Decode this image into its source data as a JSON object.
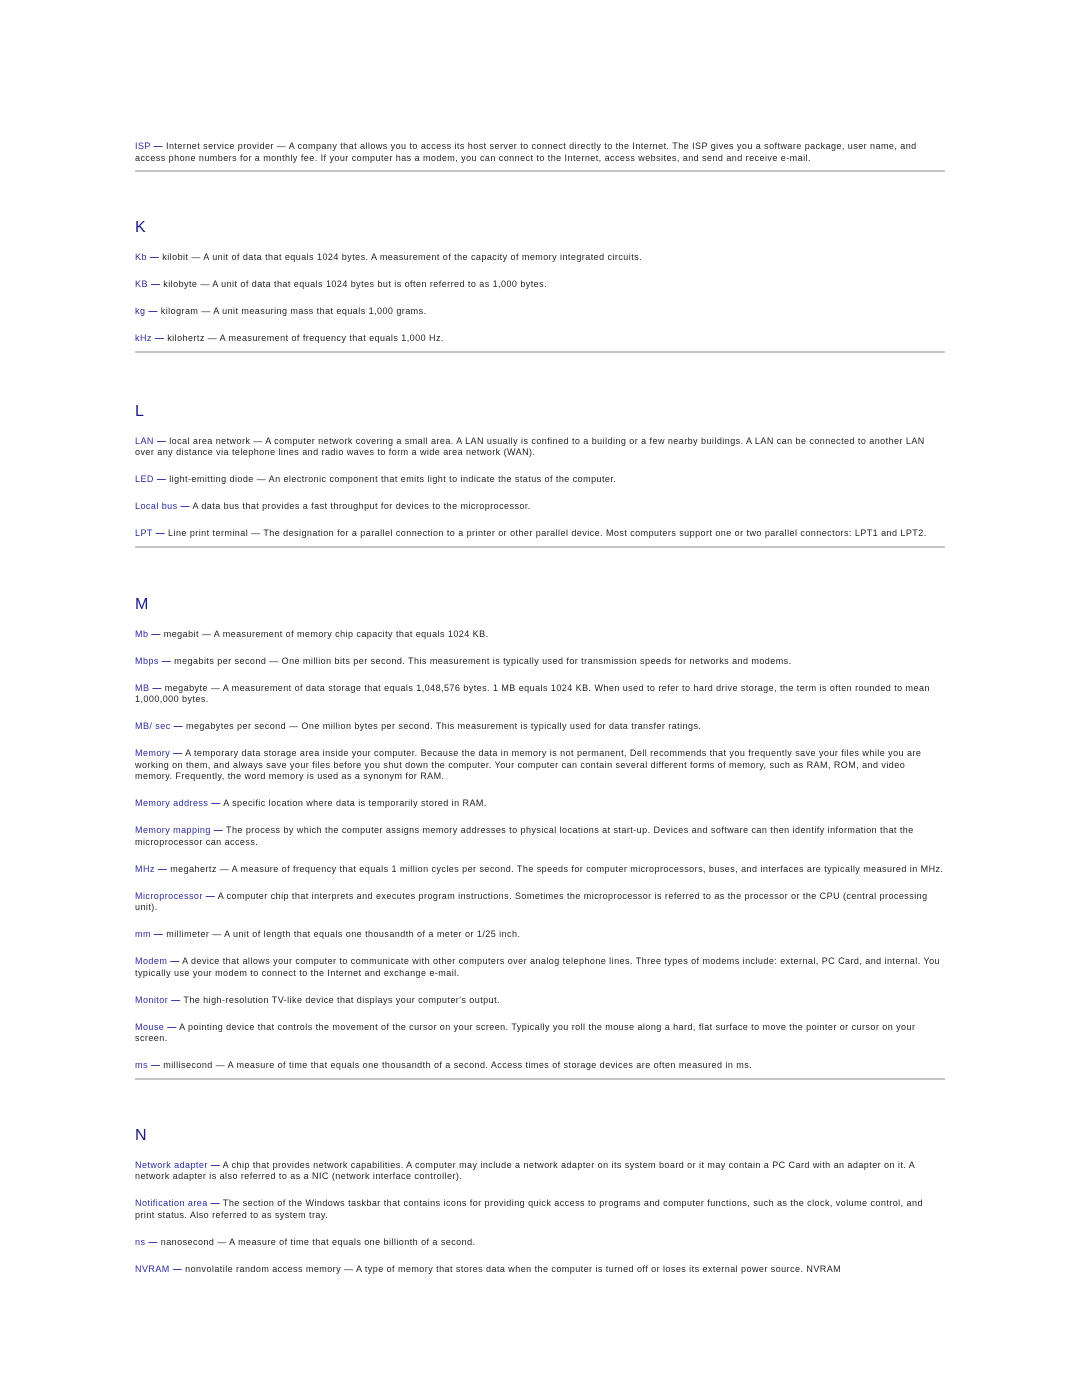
{
  "intro": {
    "term": "ISP",
    "dash": "—",
    "definition": " Internet service provider — A company that allows you to access its host server to connect directly to the Internet. The ISP gives you a software package, user name, and access phone numbers for a monthly fee. If your computer has a modem, you can connect to the Internet, access websites, and send and receive e-mail."
  },
  "sections": [
    {
      "letter": "K",
      "entries": [
        {
          "term": "Kb",
          "definition": " kilobit — A unit of data that equals 1024 bytes. A measurement of the capacity of memory integrated circuits."
        },
        {
          "term": "KB",
          "definition": " kilobyte — A unit of data that equals 1024 bytes but is often referred to as 1,000 bytes."
        },
        {
          "term": "kg",
          "definition": " kilogram — A unit measuring mass that equals 1,000 grams."
        },
        {
          "term": "kHz",
          "definition": " kilohertz — A measurement of frequency that equals 1,000 Hz."
        }
      ]
    },
    {
      "letter": "L",
      "entries": [
        {
          "term": "LAN",
          "definition": " local area network — A computer network covering a small area. A LAN usually is confined to a building or a few nearby buildings. A LAN can be connected to another LAN over any distance via telephone lines and radio waves to form a wide area network (WAN)."
        },
        {
          "term": "LED",
          "definition": " light-emitting diode — An electronic component that emits light to indicate the status of the computer."
        },
        {
          "term": "Local bus",
          "definition": " A data bus that provides a fast throughput for devices to the microprocessor."
        },
        {
          "term": "LPT",
          "definition": " Line print terminal — The designation for a parallel connection to a printer or other parallel device. Most computers support one or two parallel connectors: LPT1 and LPT2."
        }
      ]
    },
    {
      "letter": "M",
      "entries": [
        {
          "term": "Mb",
          "definition": " megabit — A measurement of memory chip capacity that equals 1024 KB."
        },
        {
          "term": "Mbps",
          "definition": " megabits per second — One million bits per second. This measurement is typically used for transmission speeds for networks and modems."
        },
        {
          "term": "MB",
          "definition": " megabyte — A measurement of data storage that equals 1,048,576 bytes. 1 MB equals 1024 KB. When used to refer to hard drive storage, the term is often rounded to mean 1,000,000 bytes."
        },
        {
          "term": "MB/ sec",
          "definition": " megabytes per second — One million bytes per second. This measurement is typically used for data transfer ratings."
        },
        {
          "term": "Memory",
          "definition": " A temporary data storage area inside your computer. Because the data in memory is not permanent, Dell recommends that you frequently save your files while you are working on them, and always save your files before you shut down the computer. Your computer can contain several different forms of memory, such as RAM, ROM, and video memory. Frequently, the word memory is used as a synonym for RAM."
        },
        {
          "term": "Memory address",
          "definition": " A specific location where data is temporarily stored in RAM."
        },
        {
          "term": "Memory mapping",
          "definition": " The process by which the computer assigns memory addresses to physical locations at start-up. Devices and software can then identify information that the microprocessor can access."
        },
        {
          "term": "MHz",
          "definition": " megahertz — A measure of frequency that equals 1 million cycles per second. The speeds for computer microprocessors, buses, and interfaces are typically measured in MHz."
        },
        {
          "term": "Microprocessor",
          "definition": " A computer chip that interprets and executes program instructions. Sometimes the microprocessor is referred to as the processor or the CPU (central processing unit)."
        },
        {
          "term": "mm",
          "definition": " millimeter — A unit of length that equals one thousandth of a meter or 1/25 inch."
        },
        {
          "term": "Modem",
          "definition": " A device that allows your computer to communicate with other computers over analog telephone lines. Three types of modems include: external, PC Card, and internal. You typically use your modem to connect to the Internet and exchange e-mail."
        },
        {
          "term": "Monitor",
          "definition": " The high-resolution TV-like device that displays your computer's output."
        },
        {
          "term": "Mouse",
          "definition": " A pointing device that controls the movement of the cursor on your screen. Typically you roll the mouse along a hard, flat surface to move the pointer or cursor on your screen."
        },
        {
          "term": "ms",
          "definition": " millisecond — A measure of time that equals one thousandth of a second. Access times of storage devices are often measured in ms."
        }
      ]
    },
    {
      "letter": "N",
      "entries": [
        {
          "term": "Network adapter",
          "definition": " A chip that provides network capabilities. A computer may include a network adapter on its system board or it may contain a PC Card with an adapter on it. A network adapter is also referred to as a NIC (network interface controller)."
        },
        {
          "term": "Notification area",
          "definition": " The section of the Windows taskbar that contains icons for providing quick access to programs and computer functions, such as the clock, volume control, and print status. Also referred to as system tray."
        },
        {
          "term": "ns",
          "definition": " nanosecond — A measure of time that equals one billionth of a second."
        },
        {
          "term": "NVRAM",
          "definition": " nonvolatile random access memory — A type of memory that stores data when the computer is turned off or loses its external power source. NVRAM"
        }
      ]
    }
  ],
  "dash": "—",
  "colors": {
    "term": "#2b2b9a",
    "heading": "#1a1a8c",
    "body": "#222222",
    "separator": "#c4c4c4"
  }
}
